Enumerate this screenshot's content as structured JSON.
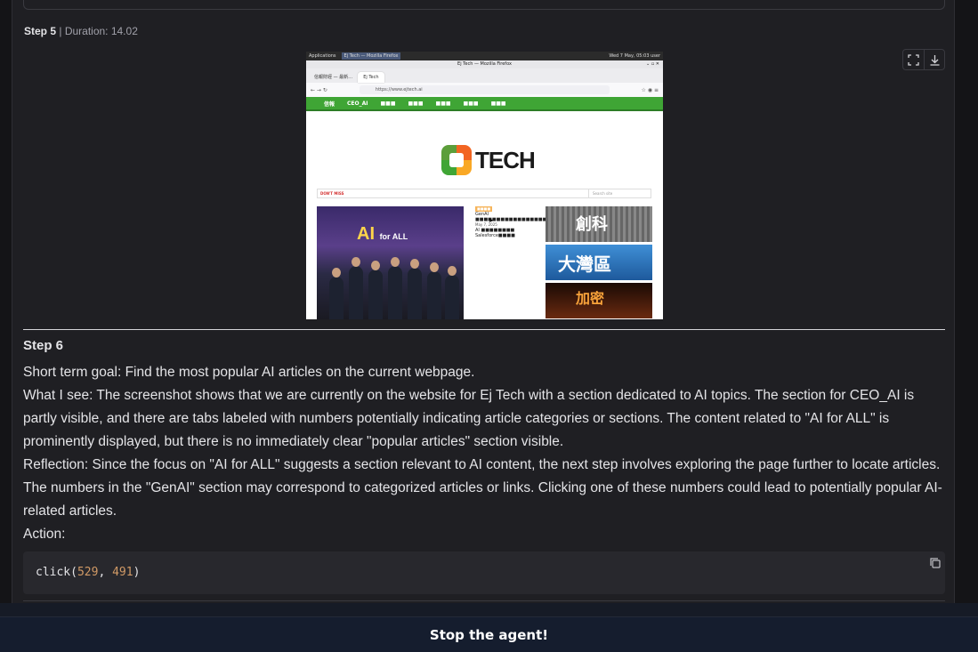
{
  "step5": {
    "label": "Step 5",
    "sep": " | ",
    "duration": "Duration: 14.02"
  },
  "screenshot": {
    "taskbar_apps": "Applications",
    "taskbar_window": "Ej Tech — Mozilla Firefox",
    "taskbar_clock": "Wed 7 May, 05:03  user",
    "window_title": "Ej Tech — Mozilla Firefox",
    "tab_first": "信報財經 — 最新…",
    "tab_active": "Ej Tech",
    "url": "https://www.ejtech.ai",
    "site_nav": [
      "信報",
      "CEO_AI",
      "■■■",
      "■■■",
      "■■■",
      "■■■",
      "■■■"
    ],
    "logo_text": "TECH",
    "breaking": "DON'T MISS",
    "search_placeholder": "Search site",
    "hero_headline": "AI",
    "hero_sub": "for ALL",
    "mid_tag": "■■■■",
    "mid_text": "GenAI ■■■■■■■■■■■■■■■■■■■■■■■■■■■■■■■■",
    "mid_date": "May 7, 2025",
    "mid_text2": "AI ■■■■■■■■ Salesforce■■■■",
    "right_box1": "創科",
    "right_box2": "大灣區",
    "right_box3": "加密"
  },
  "step6": {
    "title": "Step 6",
    "lines": [
      "Short term goal: Find the most popular AI articles on the current webpage.",
      "What I see: The screenshot shows that we are currently on the website for Ej Tech with a section dedicated to AI topics. The section for CEO_AI is partly visible, and there are tabs labeled with numbers potentially indicating article categories or sections. The content related to \"AI for ALL\" is prominently displayed, but there is no immediately clear \"popular articles\" section visible.",
      "Reflection: Since the focus on \"AI for ALL\" suggests a section relevant to AI content, the next step involves exploring the page further to locate articles. The numbers in the \"GenAI\" section may correspond to categorized articles or links. Clicking one of these numbers could lead to potentially popular AI-related articles.",
      "Action:"
    ],
    "code_fn": "click",
    "code_open": "(",
    "code_x": "529",
    "code_comma": ", ",
    "code_y": "491",
    "code_close": ")"
  },
  "stop_button": "Stop the agent!"
}
